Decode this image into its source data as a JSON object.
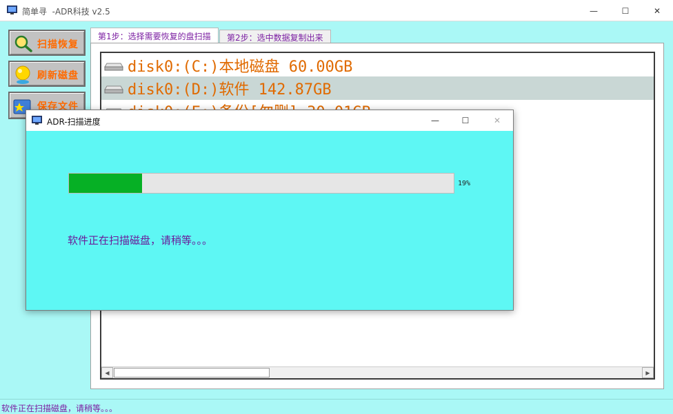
{
  "window": {
    "title": "简单寻  -ADR科技 v2.5",
    "controls": {
      "minimize": "—",
      "maximize": "☐",
      "close": "✕"
    }
  },
  "sidebar": {
    "buttons": [
      {
        "label": "扫描恢复",
        "icon": "magnifier-icon"
      },
      {
        "label": "刷新磁盘",
        "icon": "refresh-icon"
      },
      {
        "label": "保存文件",
        "icon": "save-icon"
      }
    ]
  },
  "tabs": [
    {
      "label": "第1步：选择需要恢复的盘扫描",
      "active": true
    },
    {
      "label": "第2步：选中数据复制出来",
      "active": false
    }
  ],
  "disks": [
    {
      "label": "disk0:(C:)本地磁盘 60.00GB",
      "selected": false
    },
    {
      "label": "disk0:(D:)软件 142.87GB",
      "selected": true
    },
    {
      "label": "disk0:(E:)备份[勿删] 30.01GB",
      "selected": false
    }
  ],
  "scrollbar": {
    "left_arrow": "◀",
    "right_arrow": "▶"
  },
  "statusbar": {
    "text": "软件正在扫描磁盘，请稍等。。。"
  },
  "dialog": {
    "title": "ADR-扫描进度",
    "progress": 0.19,
    "progress_label": "19%",
    "message": "软件正在扫描磁盘，请稍等。。。",
    "controls": {
      "minimize": "—",
      "maximize": "☐",
      "close": "✕"
    }
  },
  "colors": {
    "background": "#5ef7f4",
    "progress_fill": "#06b025",
    "accent_orange": "#e06a00",
    "text_purple": "#7b1fa2"
  }
}
